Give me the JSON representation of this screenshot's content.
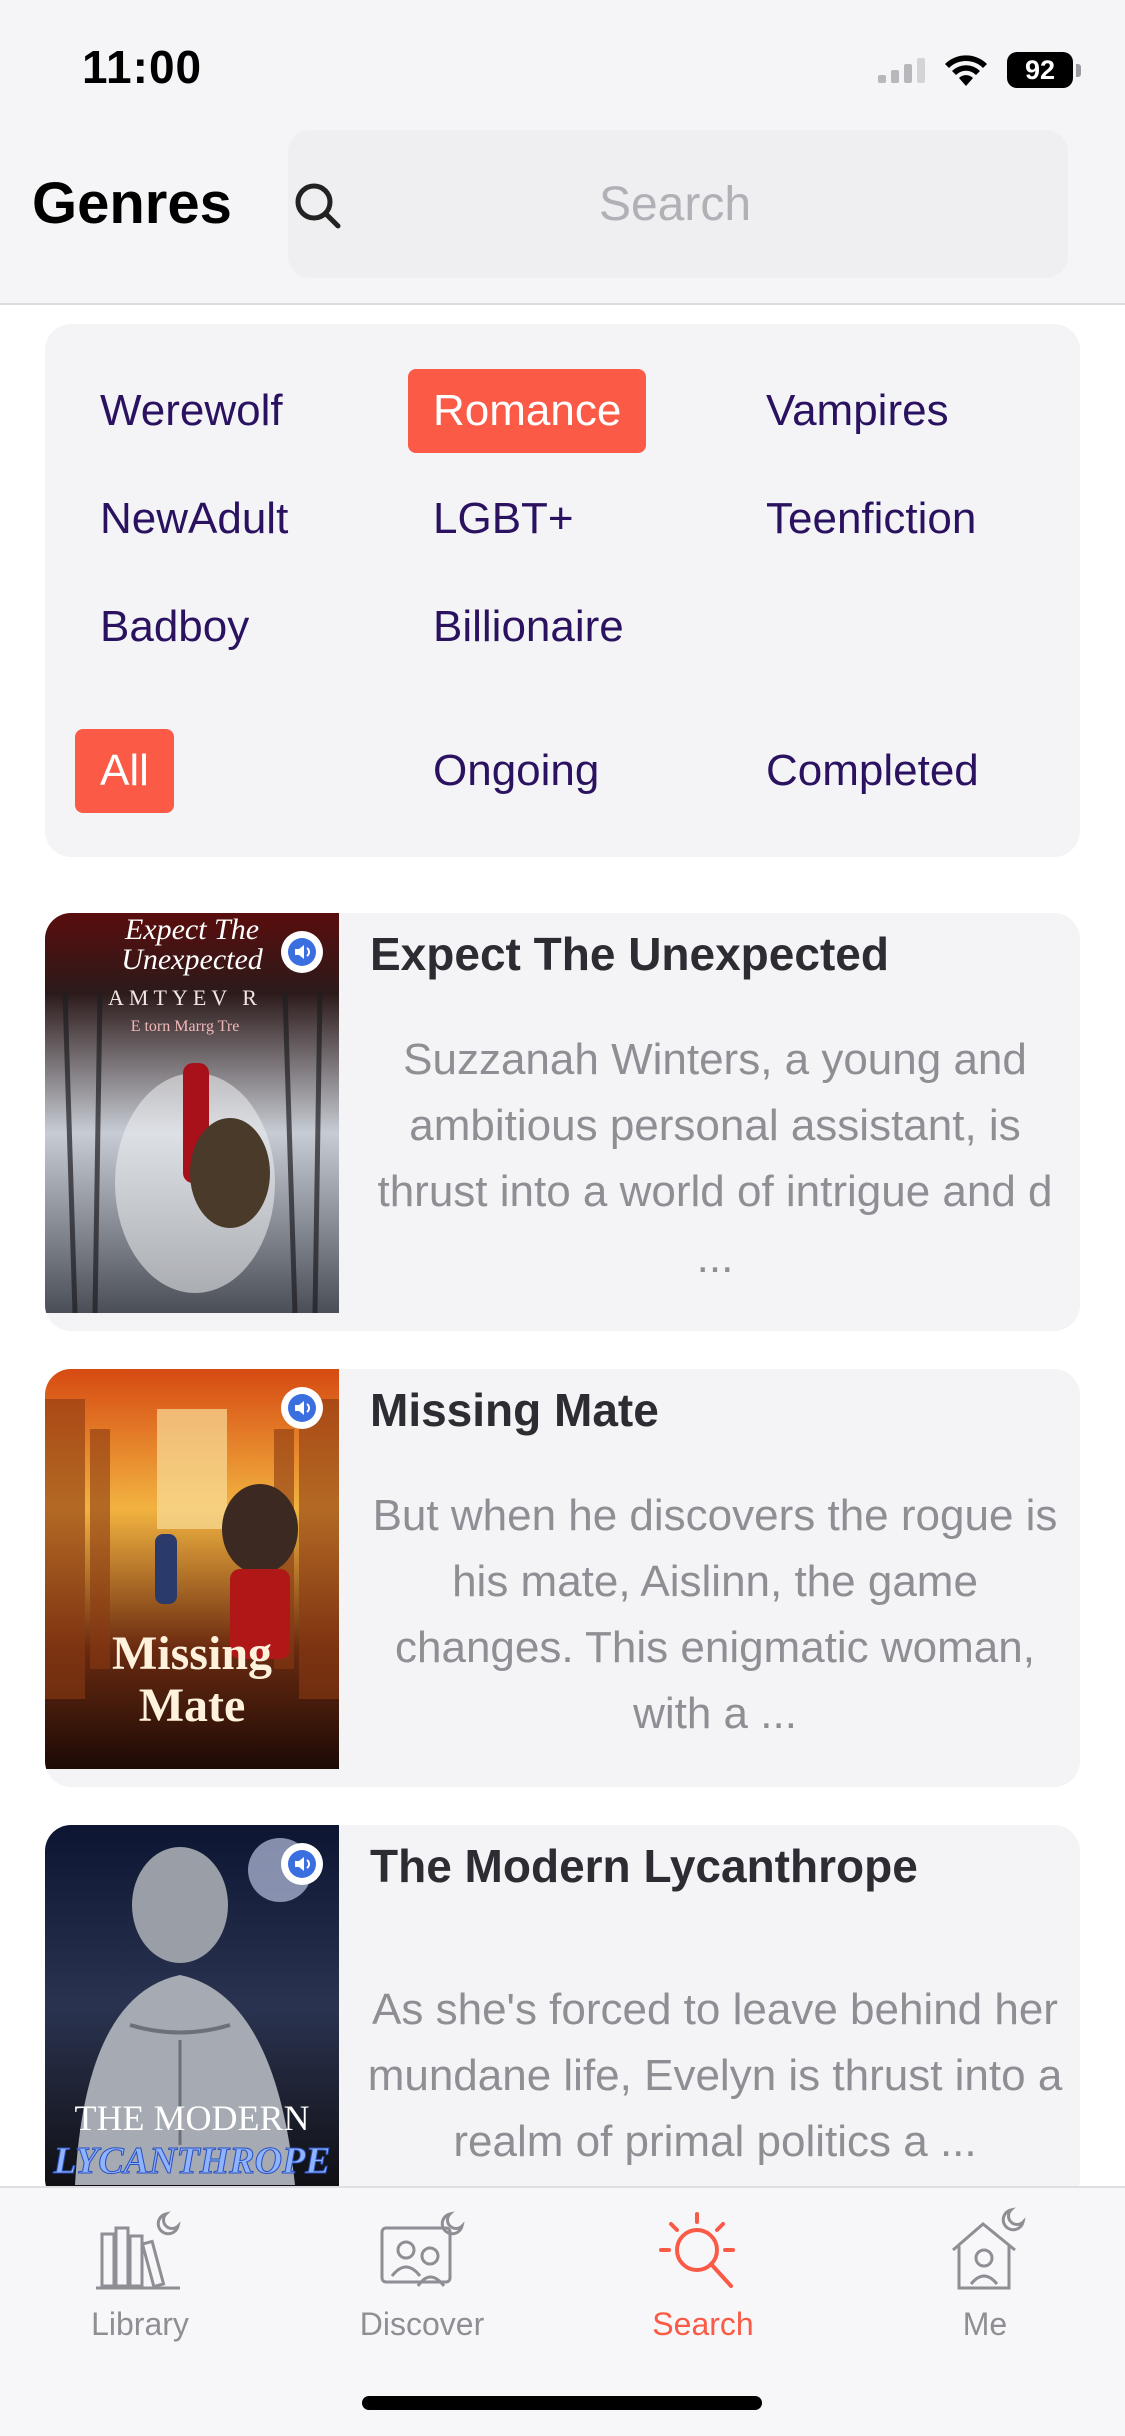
{
  "status_bar": {
    "time": "11:00",
    "battery": "92"
  },
  "header": {
    "title": "Genres",
    "search_placeholder": "Search"
  },
  "genres": [
    {
      "label": "Werewolf",
      "active": false
    },
    {
      "label": "Romance",
      "active": true
    },
    {
      "label": "Vampires",
      "active": false
    },
    {
      "label": "NewAdult",
      "active": false
    },
    {
      "label": "LGBT+",
      "active": false
    },
    {
      "label": "Teenfiction",
      "active": false
    },
    {
      "label": "Badboy",
      "active": false
    },
    {
      "label": "Billionaire",
      "active": false
    }
  ],
  "status_filters": [
    {
      "label": "All",
      "active": true
    },
    {
      "label": "Ongoing",
      "active": false
    },
    {
      "label": "Completed",
      "active": false
    }
  ],
  "books": [
    {
      "title": "Expect The Unexpected",
      "description": "Suzzanah Winters, a young and ambitious personal assistant, is thrust into a world of intrigue and d ...",
      "cover_text": [
        "Expect The",
        "Unexpected",
        "AMTYEV R",
        "E torn Marrg Tre"
      ],
      "has_audio": true
    },
    {
      "title": "Missing Mate",
      "description": "But when he discovers the rogue is his mate, Aislinn, the game changes. This enigmatic woman, with a ...",
      "cover_text": [
        "Missing",
        "Mate"
      ],
      "has_audio": true
    },
    {
      "title": "The Modern Lycanthrope",
      "description": "As she's forced to leave behind her mundane life, Evelyn is thrust into a realm of primal politics a ...",
      "cover_text": [
        "THE MODERN",
        "LYCANTHROPE"
      ],
      "has_audio": true
    }
  ],
  "tab_bar": {
    "tabs": [
      {
        "label": "Library",
        "icon": "library-icon",
        "active": false
      },
      {
        "label": "Discover",
        "icon": "discover-icon",
        "active": false
      },
      {
        "label": "Search",
        "icon": "search-icon",
        "active": true
      },
      {
        "label": "Me",
        "icon": "home-icon",
        "active": false
      }
    ]
  },
  "colors": {
    "accent": "#fa5a46",
    "genre_text": "#2a1260",
    "card_bg": "#f4f4f6"
  }
}
